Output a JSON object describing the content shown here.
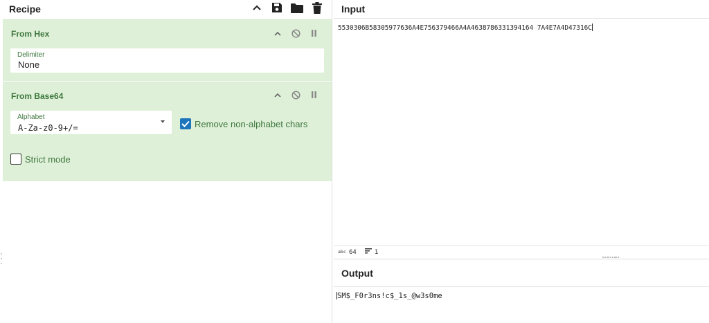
{
  "recipe": {
    "title": "Recipe",
    "header_icons": [
      "chevron-up-icon",
      "save-icon",
      "folder-icon",
      "trash-icon"
    ],
    "operations": [
      {
        "name": "From Hex",
        "controls": [
          "chevron-up-icon",
          "disable-icon",
          "pause-icon"
        ],
        "delimiter": {
          "label": "Delimiter",
          "value": "None"
        }
      },
      {
        "name": "From Base64",
        "controls": [
          "chevron-up-icon",
          "disable-icon",
          "pause-icon"
        ],
        "alphabet": {
          "label": "Alphabet",
          "value": "A-Za-z0-9+/="
        },
        "remove_non_alphabet": {
          "label": "Remove non-alphabet chars",
          "checked": true
        },
        "strict_mode": {
          "label": "Strict mode",
          "checked": false
        }
      }
    ]
  },
  "input": {
    "title": "Input",
    "text": "5530306B58305977636A4E756379466A4A4638786331394164 7A4E7A4D47316C",
    "status": {
      "chars_icon": "abc-icon",
      "length": "64",
      "lines_icon": "lines-icon",
      "lines": "1"
    }
  },
  "output": {
    "title": "Output",
    "text": "SM$_F0r3ns!c$_1s_@w3s0me"
  },
  "colors": {
    "operation_bg": "#dff0d8",
    "operation_text": "#3c763d",
    "checkbox_checked": "#1d75bc"
  }
}
